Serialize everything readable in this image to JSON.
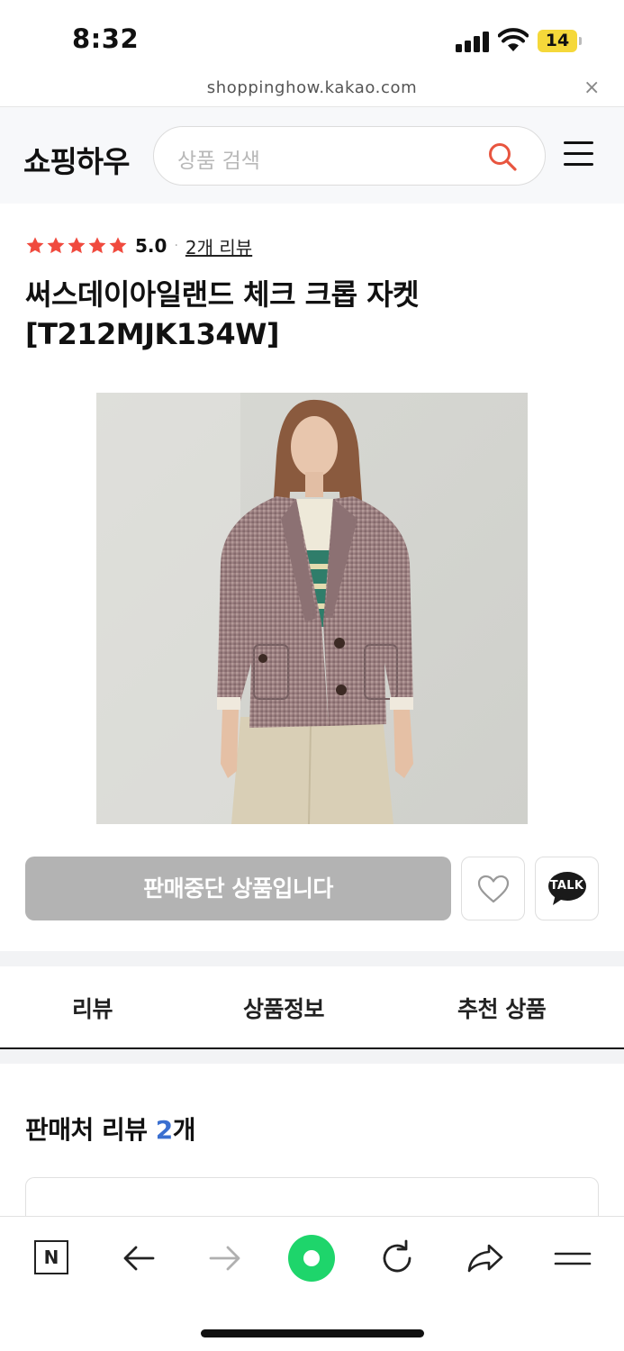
{
  "status": {
    "time": "8:32",
    "battery": "14"
  },
  "browser": {
    "url": "shoppinghow.kakao.com",
    "close_label": "×"
  },
  "header": {
    "logo": "쇼핑하우",
    "search_placeholder": "상품 검색"
  },
  "product": {
    "rating": "5.0",
    "rating_stars": 5,
    "rating_separator": "·",
    "review_link": "2개 리뷰",
    "title": "써스데이아일랜드 체크 크롭 자켓 [T212MJK134W]",
    "status_button": "판매중단 상품입니다",
    "talk_label": "TALK"
  },
  "tabs": [
    "리뷰",
    "상품정보",
    "추천 상품"
  ],
  "reviews": {
    "heading": "판매처 리뷰 ",
    "count": "2",
    "suffix": "개"
  },
  "toolbar": {
    "home_label": "N"
  },
  "colors": {
    "star": "#f04a3e",
    "accent_blue": "#3a6fd0",
    "green": "#1ed56b",
    "disabled": "#b3b3b3",
    "battery": "#f5d83a",
    "search_icon": "#e8553f"
  }
}
